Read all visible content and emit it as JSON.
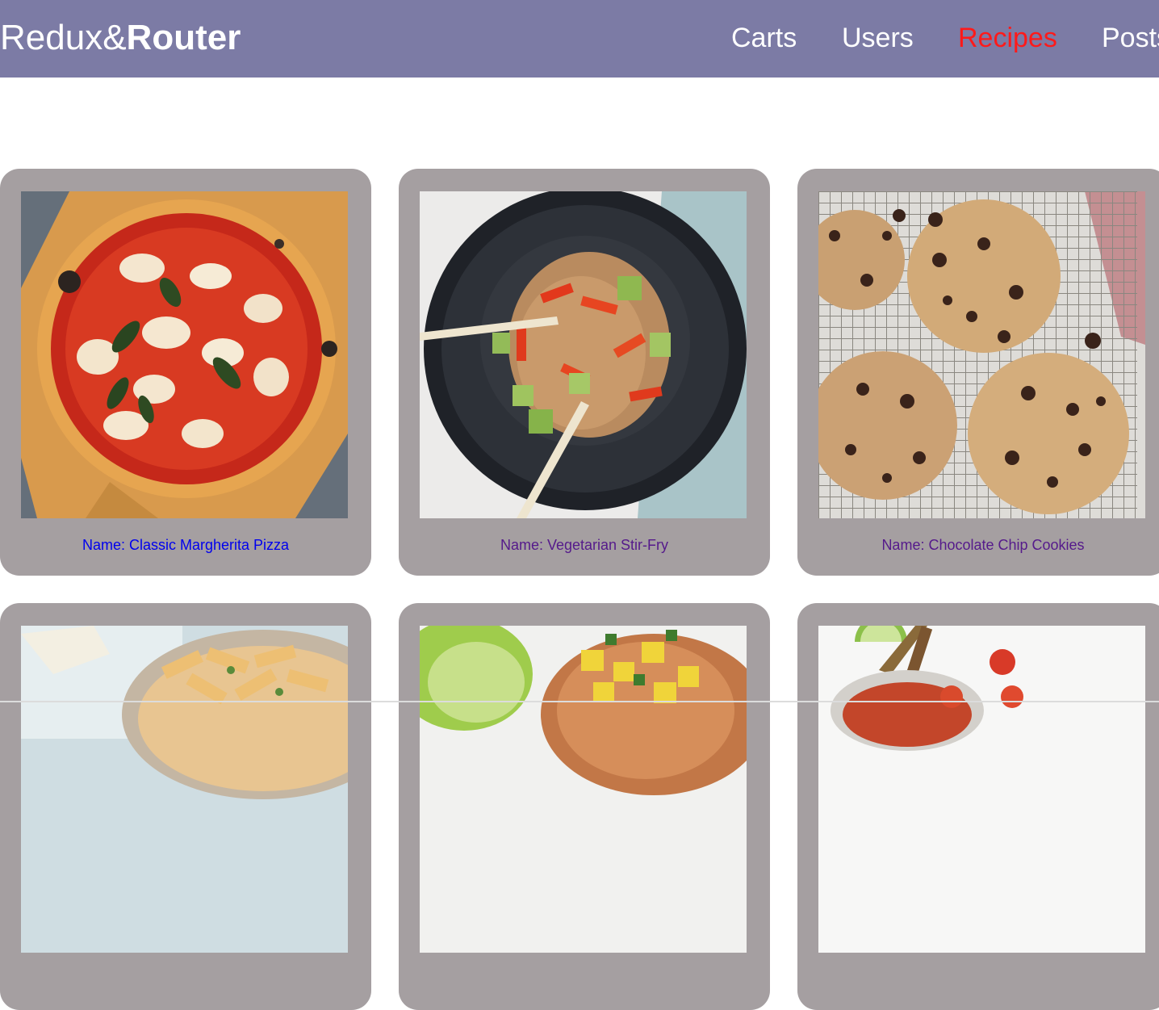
{
  "brand": {
    "regular": "Redux&",
    "bold": "Router"
  },
  "nav": [
    {
      "label": "Carts",
      "active": false
    },
    {
      "label": "Users",
      "active": false
    },
    {
      "label": "Recipes",
      "active": true
    },
    {
      "label": "Posts",
      "active": false
    }
  ],
  "recipes": [
    {
      "label": "Name: Classic Margherita Pizza",
      "image_icon": "pizza-photo"
    },
    {
      "label": "Name: Vegetarian Stir-Fry",
      "image_icon": "stir-fry-photo"
    },
    {
      "label": "Name: Chocolate Chip Cookies",
      "image_icon": "cookies-photo"
    },
    {
      "label": "",
      "image_icon": "pasta-photo"
    },
    {
      "label": "",
      "image_icon": "salad-photo"
    },
    {
      "label": "",
      "image_icon": "salsa-photo"
    }
  ],
  "colors": {
    "navbar": "#7c7ba5",
    "active_link": "#ff1a1a",
    "card": "#a59fa1",
    "link_unvisited": "#0000ee",
    "link_visited": "#551a8b"
  }
}
